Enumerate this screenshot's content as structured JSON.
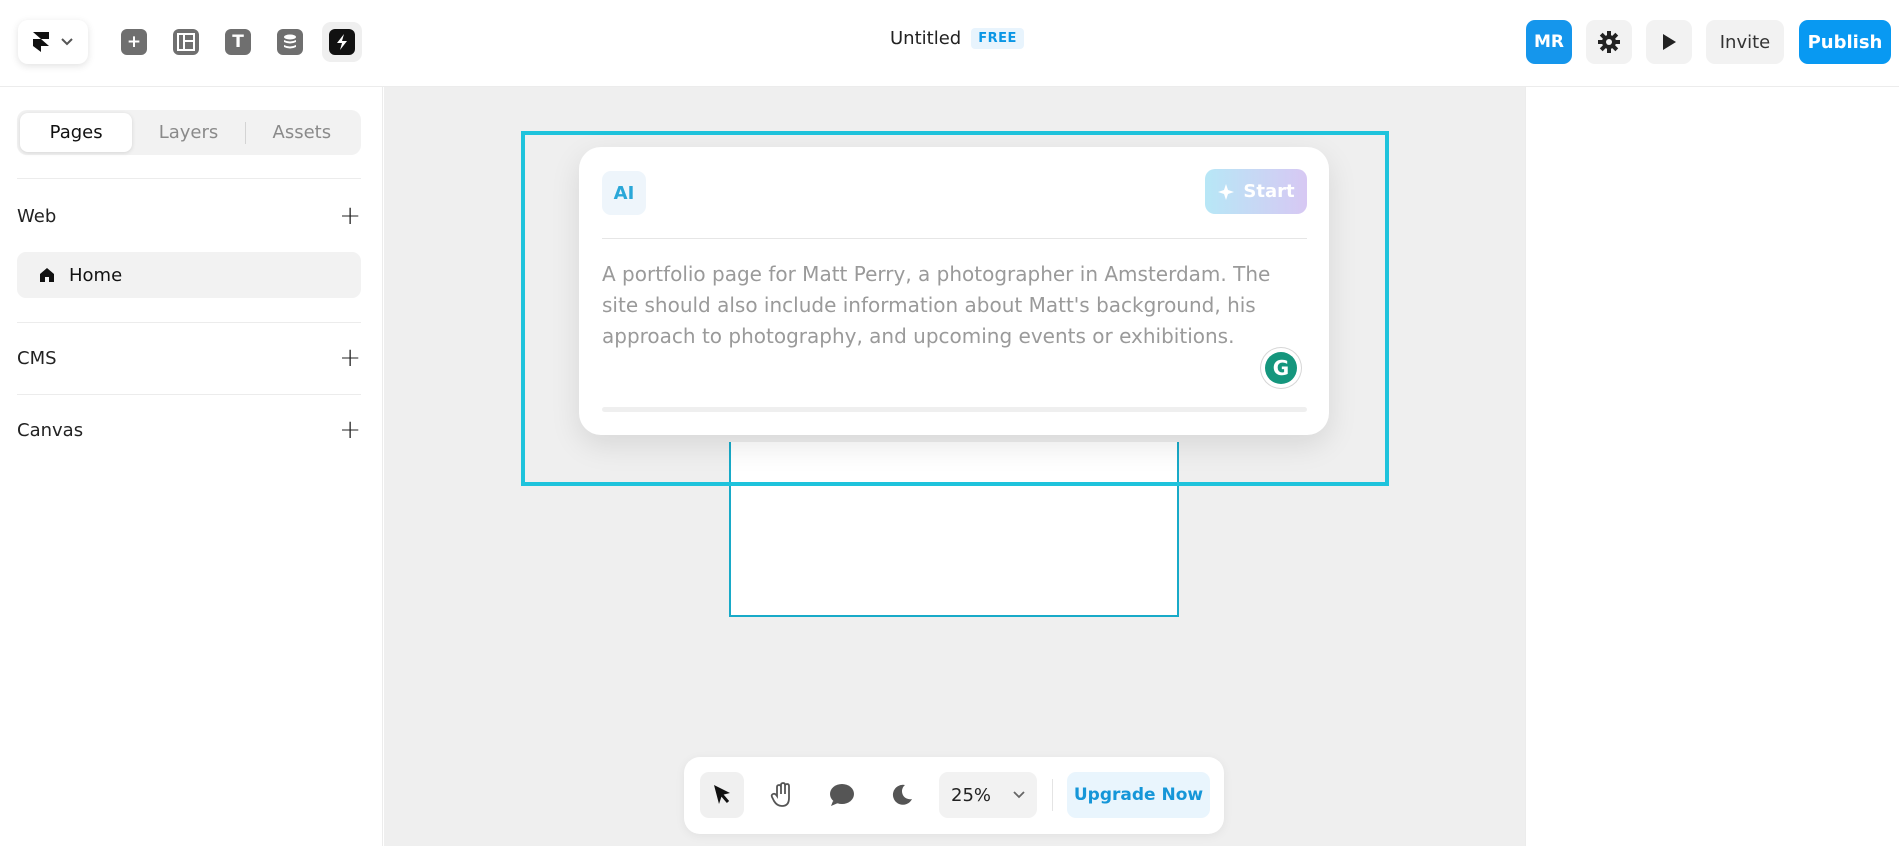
{
  "topbar": {
    "title": "Untitled",
    "plan_badge": "FREE",
    "avatar_initials": "MR",
    "invite_label": "Invite",
    "publish_label": "Publish",
    "tools": [
      "add-icon",
      "layout-icon",
      "text-icon",
      "database-icon",
      "lightning-icon"
    ]
  },
  "sidebar": {
    "tabs": [
      {
        "label": "Pages",
        "active": true
      },
      {
        "label": "Layers",
        "active": false
      },
      {
        "label": "Assets",
        "active": false
      }
    ],
    "sections": [
      {
        "title": "Web"
      },
      {
        "title": "CMS"
      },
      {
        "title": "Canvas"
      }
    ],
    "pages": [
      {
        "label": "Home",
        "icon": "home-icon"
      }
    ]
  },
  "ai_card": {
    "icon_label": "AI",
    "start_label": "Start",
    "prompt_placeholder": "A portfolio page for Matt Perry, a photographer in Amsterdam. The site should also include information about Matt's background, his approach to photography, and upcoming events or exhibitions."
  },
  "bottom_bar": {
    "zoom": "25%",
    "upgrade_label": "Upgrade Now"
  },
  "colors": {
    "accent": "#0899f2",
    "frame_highlight": "#1ec3dc",
    "canvas_bg": "#efefef"
  }
}
